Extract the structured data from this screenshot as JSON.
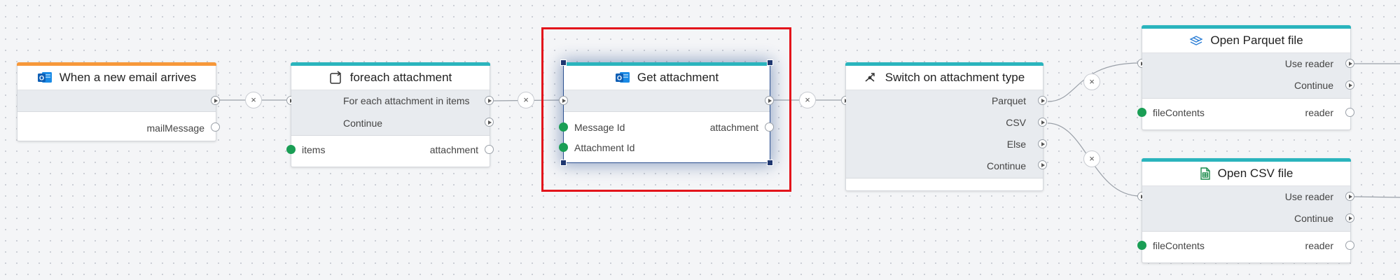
{
  "nodes": {
    "trigger": {
      "title": "When a new email arrives",
      "icon": "outlook-icon",
      "accent": "#f7983a",
      "output": "mailMessage"
    },
    "foreach": {
      "title": "foreach attachment",
      "icon": "loop-icon",
      "accent": "#2ab4bd",
      "flow_each": "For each attachment in items",
      "flow_continue": "Continue",
      "input": "items",
      "output": "attachment"
    },
    "get_attachment": {
      "title": "Get attachment",
      "icon": "outlook-icon",
      "accent": "#2ab4bd",
      "input_message": "Message Id",
      "input_attachment": "Attachment Id",
      "output": "attachment",
      "selected": true
    },
    "switch": {
      "title": "Switch on attachment type",
      "icon": "switch-icon",
      "accent": "#2ab4bd",
      "case_parquet": "Parquet",
      "case_csv": "CSV",
      "case_else": "Else",
      "case_continue": "Continue"
    },
    "parquet": {
      "title": "Open Parquet file",
      "icon": "parquet-icon",
      "accent": "#2ab4bd",
      "use_reader": "Use reader",
      "continue": "Continue",
      "input": "fileContents",
      "output": "reader"
    },
    "csv": {
      "title": "Open CSV file",
      "icon": "csv-file-icon",
      "accent": "#2ab4bd",
      "use_reader": "Use reader",
      "continue": "Continue",
      "input": "fileContents",
      "output": "reader"
    }
  },
  "connectors": {
    "remove_glyph": "×"
  },
  "colors": {
    "canvas": "#f4f5f7",
    "highlight": "#e3141b",
    "port_green": "#1a9e55",
    "selection": "#2a4f8f"
  }
}
